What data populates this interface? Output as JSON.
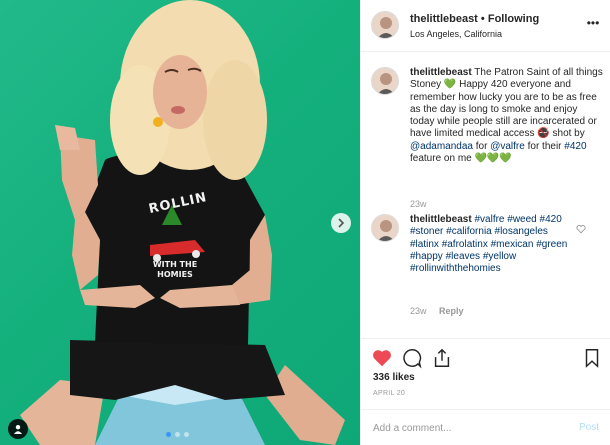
{
  "post": {
    "username": "thelittlebeast",
    "separator": "•",
    "follow_status": "Following",
    "location": "Los Angeles, California",
    "more_label": "•••"
  },
  "caption": {
    "username": "thelittlebeast",
    "text": "The Patron Saint of all things Stoney 💚 Happy 420 everyone and remember how lucky you are to be as free as the day is long to smoke and enjoy today while people still are incarcerated or have limited medical access 🚭 shot by",
    "mention_1": "@adamandaa",
    "mid_text": "for",
    "mention_2": "@valfre",
    "end_text": "for their",
    "hashtag": "#420",
    "tail": "feature on me 💚💚💚",
    "time": "23w"
  },
  "comment": {
    "username": "thelittlebeast",
    "hashtags": [
      "#valfre",
      "#weed",
      "#420",
      "#stoner",
      "#california",
      "#losangeles",
      "#latinx",
      "#afrolatinx",
      "#mexican",
      "#green",
      "#happy",
      "#leaves",
      "#yellow",
      "#rollinwiththehomies"
    ],
    "time": "23w",
    "reply_label": "Reply"
  },
  "shirt": {
    "line1": "ROLLIN",
    "line2": "WITH THE",
    "line3": "HOMIES"
  },
  "engagement": {
    "likes": "336 likes",
    "date": "APRIL 20"
  },
  "composer": {
    "placeholder": "Add a comment...",
    "post_label": "Post"
  },
  "carousel": {
    "count": 3,
    "active": 0
  },
  "colors": {
    "background_green": "#14b07c",
    "like_red": "#ed4956",
    "link_blue": "#003569",
    "post_blue": "#b2dffc"
  }
}
